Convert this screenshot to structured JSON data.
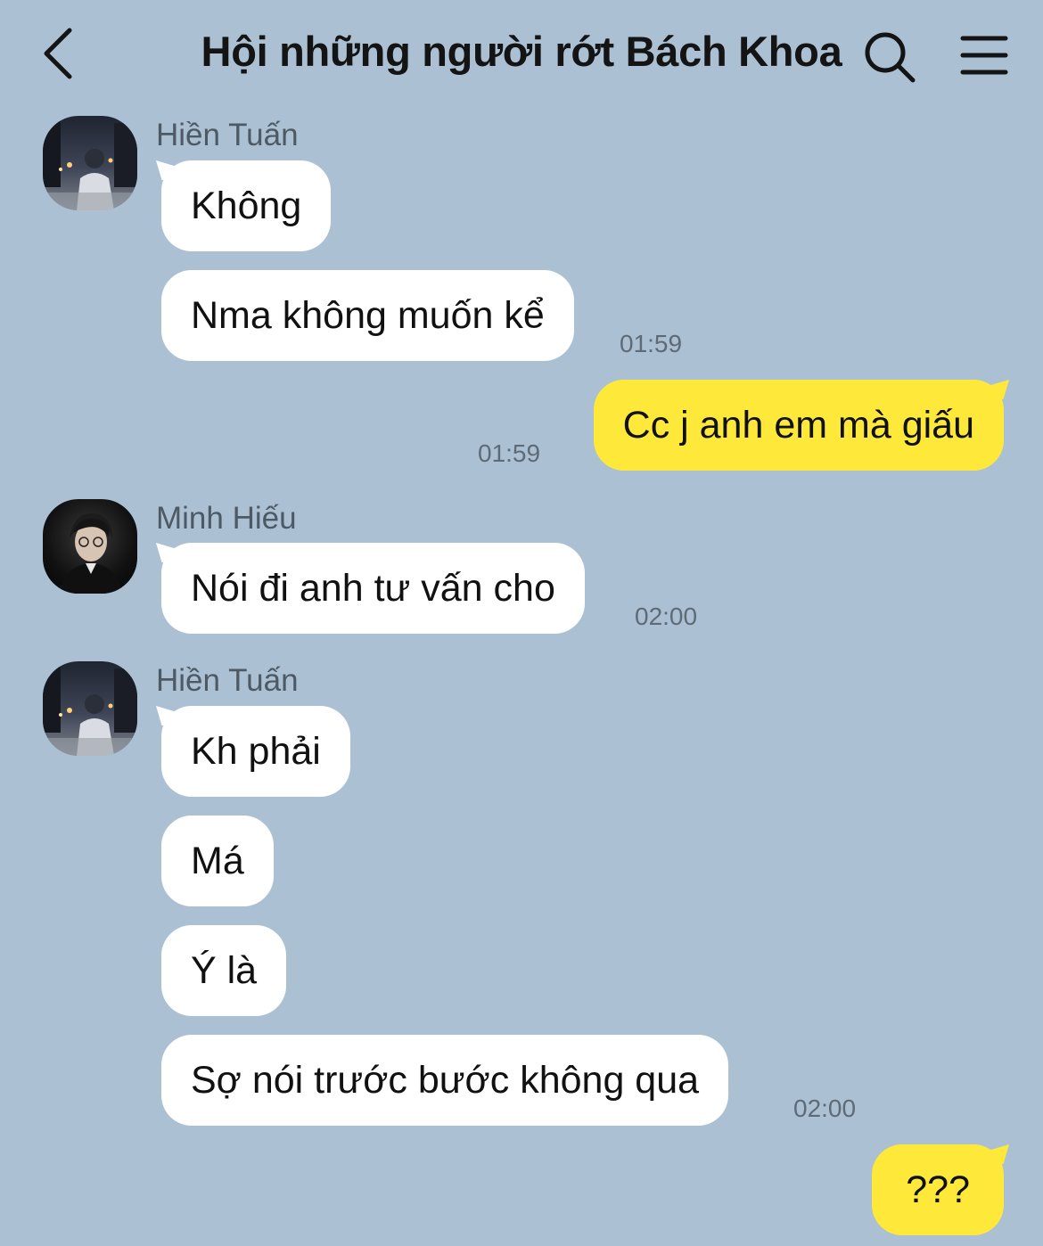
{
  "header": {
    "title": "Hội những người rớt Bách Khoa",
    "back_icon": "chevron-left-icon",
    "search_icon": "search-icon",
    "menu_icon": "hamburger-menu-icon"
  },
  "colors": {
    "background": "#abc1d3",
    "incoming_bubble": "#ffffff",
    "outgoing_bubble": "#fee93a"
  },
  "messages": [
    {
      "sender": "Hiền Tuấn",
      "text": "Không",
      "direction": "incoming"
    },
    {
      "text": "Nma không muốn kể",
      "direction": "incoming",
      "time": "01:59"
    },
    {
      "text": "Cc j anh em mà giấu",
      "direction": "outgoing",
      "time": "01:59"
    },
    {
      "sender": "Minh Hiếu",
      "text": "Nói đi anh tư vấn cho",
      "direction": "incoming",
      "time": "02:00"
    },
    {
      "sender": "Hiền Tuấn",
      "text": "Kh phải",
      "direction": "incoming"
    },
    {
      "text": "Má",
      "direction": "incoming"
    },
    {
      "text": "Ý là",
      "direction": "incoming"
    },
    {
      "text": "Sợ nói trước bước không qua",
      "direction": "incoming",
      "time": "02:00"
    },
    {
      "text": "???",
      "direction": "outgoing"
    }
  ]
}
